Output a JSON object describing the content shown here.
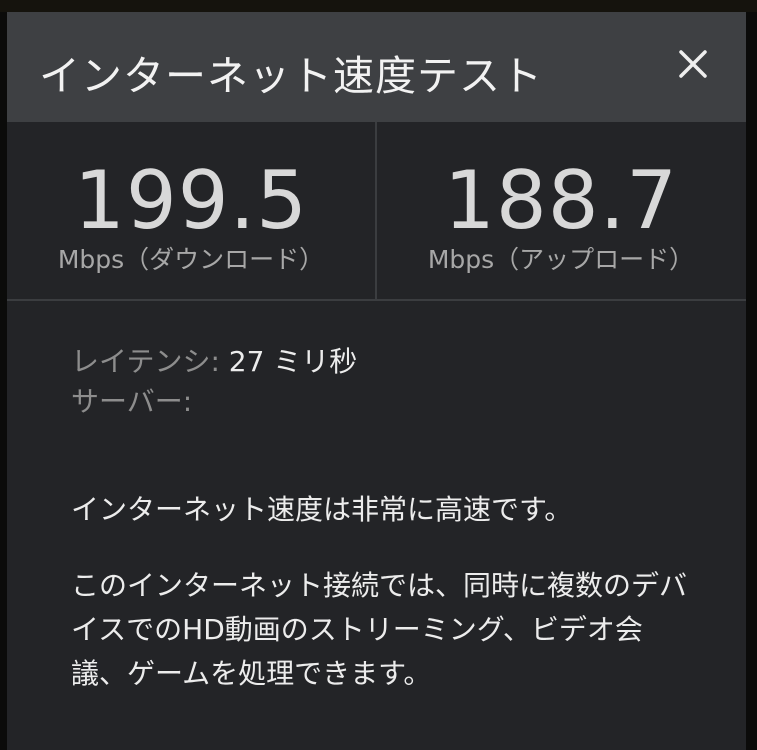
{
  "dialog": {
    "title": "インターネット速度テスト",
    "close_icon": "close-icon"
  },
  "results": {
    "download_value": "199.5",
    "download_label": "Mbps（ダウンロード）",
    "upload_value": "188.7",
    "upload_label": "Mbps（アップロード）"
  },
  "details": {
    "latency_label": "レイテンシ:",
    "latency_value": "27 ミリ秒",
    "server_label": "サーバー:",
    "server_value": ""
  },
  "summary": {
    "headline": "インターネット速度は非常に高速です。",
    "description": "このインターネット接続では、同時に複数のデバイスでのHD動画のストリーミング、ビデオ会議、ゲームを処理できます。"
  },
  "colors": {
    "header_bg": "#3e4043",
    "body_bg": "#232427",
    "text_primary": "#ececec",
    "text_secondary": "#8d8d8d"
  }
}
